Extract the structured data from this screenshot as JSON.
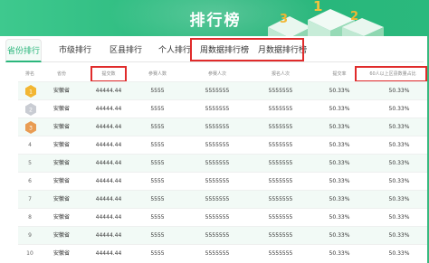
{
  "banner": {
    "title": "排行榜"
  },
  "tabs": [
    {
      "label": "省份排行",
      "active": true
    },
    {
      "label": "市级排行",
      "active": false
    },
    {
      "label": "区县排行",
      "active": false
    },
    {
      "label": "个人排行",
      "active": false
    },
    {
      "label": "周数据排行榜",
      "active": false
    },
    {
      "label": "月数据排行榜",
      "active": false
    }
  ],
  "table": {
    "headers": [
      "排名",
      "省份",
      "提交数",
      "参赛人数",
      "参赛人次",
      "报名人次",
      "提交率",
      "60人以上区县数量占比"
    ],
    "rows": [
      {
        "rank": "1",
        "medal": "gold",
        "province": "安徽省",
        "c1": "44444.44",
        "c2": "5555",
        "c3": "5555555",
        "c4": "5555555",
        "c5": "50.33%",
        "c6": "50.33%"
      },
      {
        "rank": "2",
        "medal": "silver",
        "province": "安徽省",
        "c1": "44444.44",
        "c2": "5555",
        "c3": "5555555",
        "c4": "5555555",
        "c5": "50.33%",
        "c6": "50.33%"
      },
      {
        "rank": "3",
        "medal": "bronze",
        "province": "安徽省",
        "c1": "44444.44",
        "c2": "5555",
        "c3": "5555555",
        "c4": "5555555",
        "c5": "50.33%",
        "c6": "50.33%"
      },
      {
        "rank": "4",
        "medal": "",
        "province": "安徽省",
        "c1": "44444.44",
        "c2": "5555",
        "c3": "5555555",
        "c4": "5555555",
        "c5": "50.33%",
        "c6": "50.33%"
      },
      {
        "rank": "5",
        "medal": "",
        "province": "安徽省",
        "c1": "44444.44",
        "c2": "5555",
        "c3": "5555555",
        "c4": "5555555",
        "c5": "50.33%",
        "c6": "50.33%"
      },
      {
        "rank": "6",
        "medal": "",
        "province": "安徽省",
        "c1": "44444.44",
        "c2": "5555",
        "c3": "5555555",
        "c4": "5555555",
        "c5": "50.33%",
        "c6": "50.33%"
      },
      {
        "rank": "7",
        "medal": "",
        "province": "安徽省",
        "c1": "44444.44",
        "c2": "5555",
        "c3": "5555555",
        "c4": "5555555",
        "c5": "50.33%",
        "c6": "50.33%"
      },
      {
        "rank": "8",
        "medal": "",
        "province": "安徽省",
        "c1": "44444.44",
        "c2": "5555",
        "c3": "5555555",
        "c4": "5555555",
        "c5": "50.33%",
        "c6": "50.33%"
      },
      {
        "rank": "9",
        "medal": "",
        "province": "安徽省",
        "c1": "44444.44",
        "c2": "5555",
        "c3": "5555555",
        "c4": "5555555",
        "c5": "50.33%",
        "c6": "50.33%"
      },
      {
        "rank": "10",
        "medal": "",
        "province": "安徽省",
        "c1": "44444.44",
        "c2": "5555",
        "c3": "5555555",
        "c4": "5555555",
        "c5": "50.33%",
        "c6": "50.33%"
      }
    ]
  },
  "colors": {
    "accent": "#2bb67c",
    "highlight_box": "#e02b2b",
    "gold": "#f2b632",
    "silver": "#c9ccd3",
    "bronze": "#e99c53"
  }
}
